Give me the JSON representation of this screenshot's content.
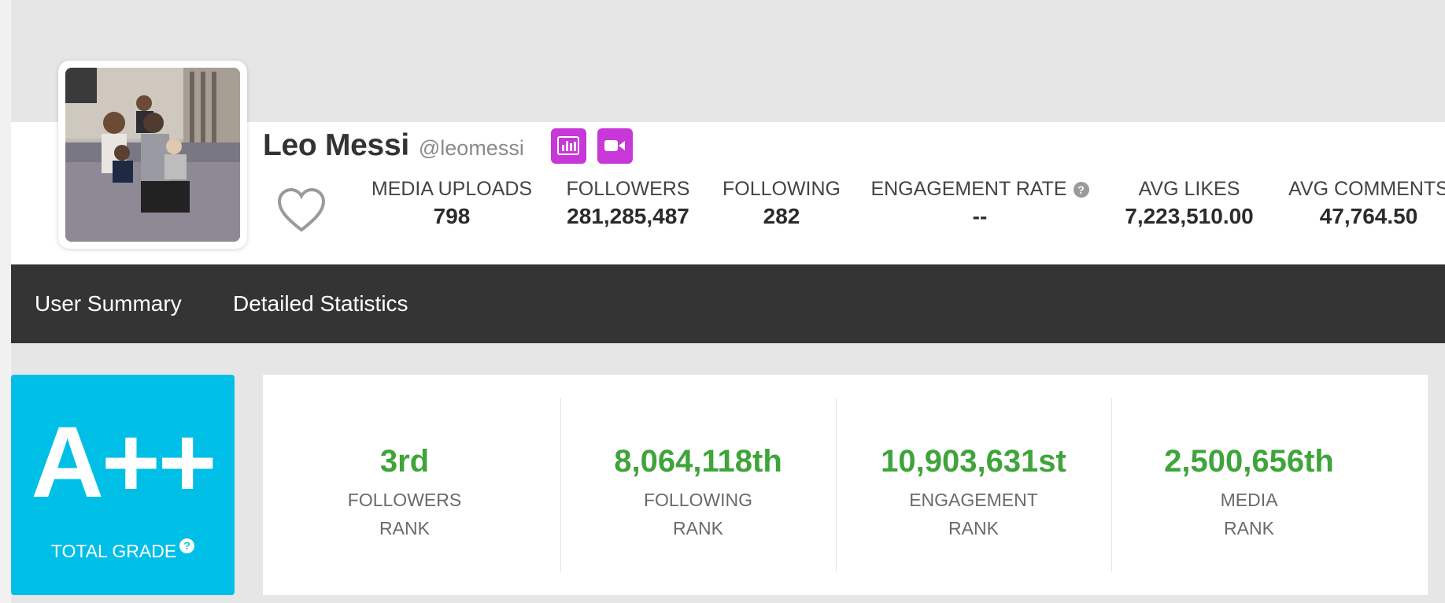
{
  "profile": {
    "name": "Leo Messi",
    "handle": "@leomessi"
  },
  "stats": [
    {
      "label": "MEDIA UPLOADS",
      "value": "798"
    },
    {
      "label": "FOLLOWERS",
      "value": "281,285,487"
    },
    {
      "label": "FOLLOWING",
      "value": "282"
    },
    {
      "label": "ENGAGEMENT RATE",
      "value": "--"
    },
    {
      "label": "AVG LIKES",
      "value": "7,223,510.00"
    },
    {
      "label": "AVG COMMENTS",
      "value": "47,764.50"
    }
  ],
  "nav": {
    "items": [
      "User Summary",
      "Detailed Statistics"
    ]
  },
  "grade": {
    "value": "A++",
    "label": "TOTAL GRADE"
  },
  "ranks": [
    {
      "value": "3rd",
      "label_1": "FOLLOWERS",
      "label_2": "RANK"
    },
    {
      "value": "8,064,118th",
      "label_1": "FOLLOWING",
      "label_2": "RANK"
    },
    {
      "value": "10,903,631st",
      "label_1": "ENGAGEMENT",
      "label_2": "RANK"
    },
    {
      "value": "2,500,656th",
      "label_1": "MEDIA",
      "label_2": "RANK"
    }
  ],
  "icons": {
    "stats_button": "bar-chart-icon",
    "video_button": "video-camera-icon",
    "favorite": "heart-icon",
    "help": "question-icon"
  },
  "colors": {
    "accent_purple": "#c837d8",
    "grade_blue": "#00bfe6",
    "rank_green": "#3fa43a",
    "navbar": "#343434"
  }
}
